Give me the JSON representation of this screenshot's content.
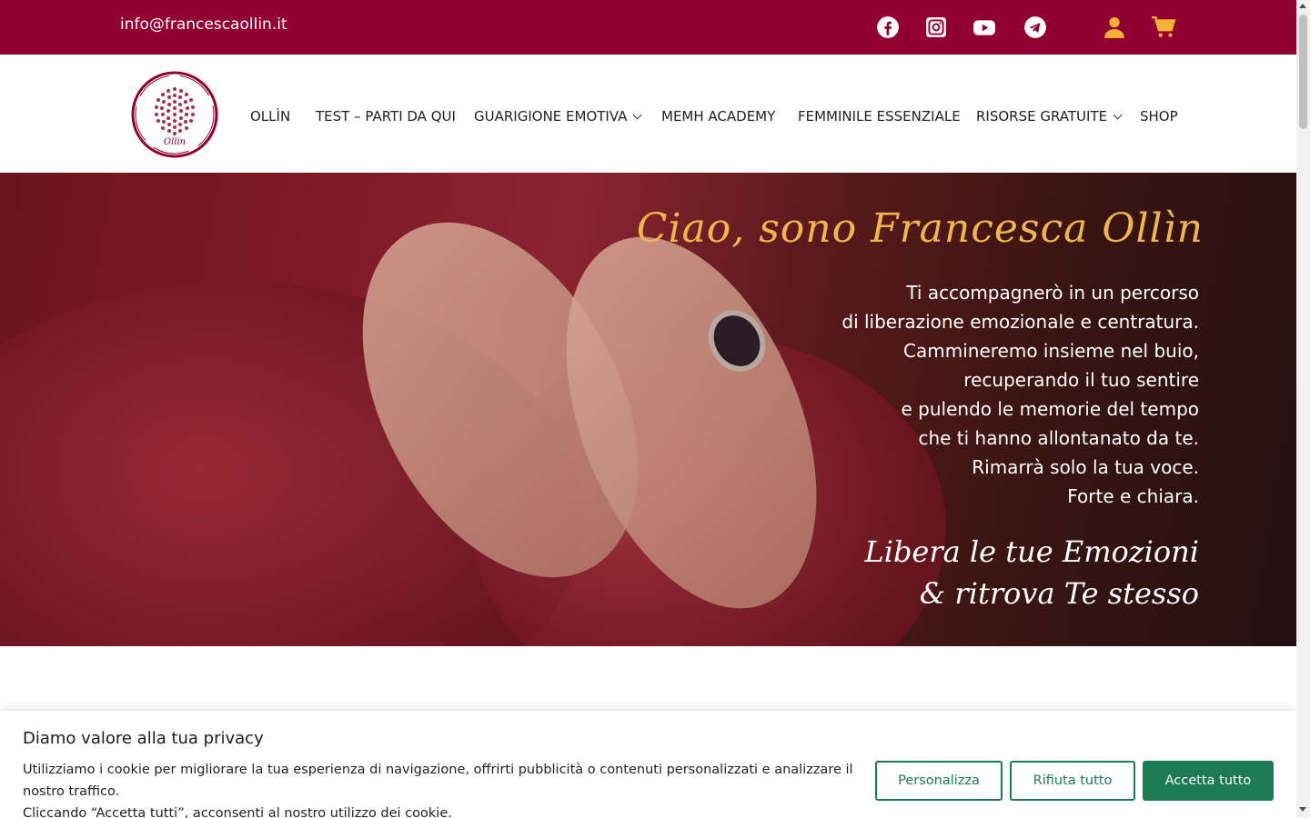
{
  "topbar": {
    "email": "info@francescaollin.it",
    "bg_color": "#920031",
    "icons": [
      "facebook-icon",
      "instagram-icon",
      "youtube-icon",
      "telegram-icon",
      "user-icon",
      "cart-icon"
    ],
    "accent_color": "#f5b335"
  },
  "header": {
    "logo_text": "Ollin",
    "nav": [
      {
        "label": "OLLÌN",
        "has_dropdown": false
      },
      {
        "label": "TEST – PARTI DA QUI",
        "has_dropdown": false
      },
      {
        "label": "GUARIGIONE EMOTIVA",
        "has_dropdown": true
      },
      {
        "label": "MEMH ACADEMY",
        "has_dropdown": false
      },
      {
        "label": "FEMMINILE ESSENZIALE",
        "has_dropdown": false
      },
      {
        "label": "RISORSE GRATUITE",
        "has_dropdown": true
      },
      {
        "label": "SHOP",
        "has_dropdown": false
      }
    ]
  },
  "hero": {
    "title": "Ciao, sono Francesca Ollìn",
    "lines": [
      "Ti accompagnerò in un percorso",
      "di liberazione emozionale e centratura.",
      "Cammineremo insieme nel buio,",
      "recuperando il tuo sentire",
      "e pulendo le memorie del tempo",
      "che ti hanno allontanato da te.",
      "Rimarrà solo la tua voce.",
      "Forte e chiara."
    ],
    "tagline": [
      "Libera le tue Emozioni",
      "& ritrova Te stesso"
    ],
    "title_color": "#f2b44c"
  },
  "cookie": {
    "title": "Diamo valore alla tua privacy",
    "text_line1": "Utilizziamo i cookie per migliorare la tua esperienza di navigazione, offrirti pubblicità o contenuti personalizzati e analizzare il nostro traffico.",
    "text_line2": "Cliccando “Accetta tutti”, acconsenti al nostro utilizzo dei cookie.",
    "customize": "Personalizza",
    "reject": "Rifiuta tutto",
    "accept": "Accetta tutto",
    "button_color": "#1c7a55"
  }
}
